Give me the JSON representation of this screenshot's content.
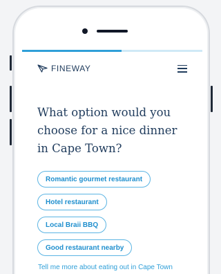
{
  "progress": {
    "fraction": 0.55
  },
  "header": {
    "brand_name": "FINEWAY",
    "logo_icon": "fineway-arrow-icon",
    "menu_icon": "hamburger-menu-icon"
  },
  "main": {
    "question": "What option would you choose for a nice dinner in Cape Town?",
    "options": [
      {
        "label": "Romantic gourmet restaurant"
      },
      {
        "label": "Hotel restaurant"
      },
      {
        "label": "Local Braii BBQ"
      },
      {
        "label": "Good restaurant nearby"
      }
    ],
    "more_link": "Tell me more about eating out in Cape Town"
  },
  "colors": {
    "accent": "#2f9fd8",
    "heading": "#1f3b5c",
    "progress_track": "#cfe9f6"
  }
}
